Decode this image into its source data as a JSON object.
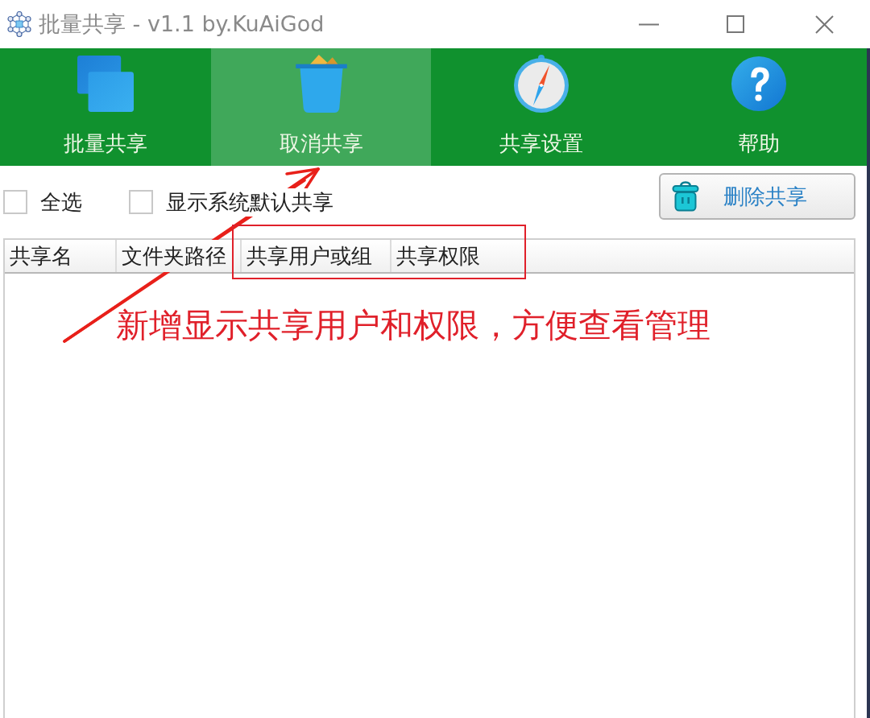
{
  "window": {
    "title": "批量共享 - v1.1 by.KuAiGod"
  },
  "toolbar": {
    "tabs": [
      {
        "label": "批量共享",
        "kind": "squares",
        "selected": false
      },
      {
        "label": "取消共享",
        "kind": "bin",
        "selected": true
      },
      {
        "label": "共享设置",
        "kind": "compass",
        "selected": false
      },
      {
        "label": "帮助",
        "kind": "help",
        "selected": false
      }
    ]
  },
  "options": {
    "checkboxes": [
      {
        "label": "全选",
        "checked": false
      },
      {
        "label": "显示系统默认共享",
        "checked": false
      }
    ],
    "delete_button": {
      "label": "删除共享"
    }
  },
  "table": {
    "columns": [
      "共享名",
      "文件夹路径",
      "共享用户或组",
      "共享权限"
    ]
  },
  "annotation": {
    "text": "新增显示共享用户和权限，方便查看管理"
  }
}
